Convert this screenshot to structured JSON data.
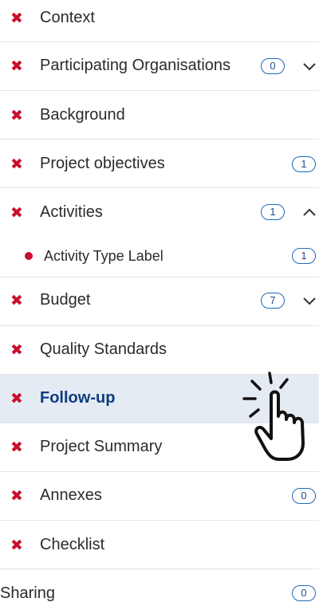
{
  "nav": {
    "items": [
      {
        "label": "Context",
        "status": "incomplete"
      },
      {
        "label": "Participating Organisations",
        "status": "incomplete",
        "badge": "0",
        "expanded": false
      },
      {
        "label": "Background",
        "status": "incomplete"
      },
      {
        "label": "Project objectives",
        "status": "incomplete",
        "badge": "1"
      },
      {
        "label": "Activities",
        "status": "incomplete",
        "badge": "1",
        "expanded": true
      },
      {
        "label": "Activity Type Label",
        "status": "incomplete",
        "badge": "1",
        "sub": true
      },
      {
        "label": "Budget",
        "status": "incomplete",
        "badge": "7",
        "expanded": false
      },
      {
        "label": "Quality Standards",
        "status": "incomplete"
      },
      {
        "label": "Follow-up",
        "status": "incomplete",
        "active": true
      },
      {
        "label": "Project Summary",
        "status": "incomplete"
      },
      {
        "label": "Annexes",
        "status": "incomplete",
        "badge": "0"
      },
      {
        "label": "Checklist",
        "status": "incomplete"
      },
      {
        "label": "Sharing",
        "badge": "0"
      }
    ]
  },
  "icons": {
    "status": "x-mark-icon",
    "sub_status": "dot-icon",
    "expand": "chevron-down-icon",
    "collapse": "chevron-up-icon",
    "pointer": "hand-pointer-icon"
  },
  "colors": {
    "error_red": "#c8102e",
    "badge_blue": "#1e6bb8",
    "active_bg": "#e5ebf3",
    "active_text": "#0d3c80"
  }
}
